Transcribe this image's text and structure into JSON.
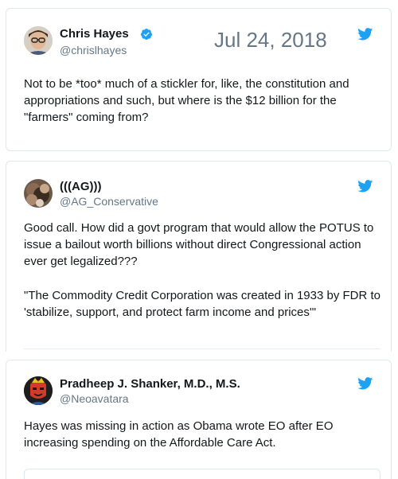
{
  "tweets": [
    {
      "name": "Chris Hayes",
      "handle": "@chrislhayes",
      "date": "Jul 24, 2018",
      "text": "Not to be *too* much of a stickler for, like, the constitution and appropriations and such, but where is the $12 billion for the \"farmers\" coming from?",
      "verified": true,
      "icon": "twitter-bird-icon"
    },
    {
      "name": "(((AG)))",
      "handle": "@AG_Conservative",
      "text1": "Good call. How did a govt program that would allow the POTUS to issue a bailout worth billions without direct Congressional action ever get legalized???",
      "text2": "\"The Commodity Credit Corporation was created in 1933 by FDR to 'stabilize, support, and protect farm income and prices'\"",
      "icon": "twitter-bird-icon"
    },
    {
      "name": "Pradheep J. Shanker, M.D., M.S.",
      "handle": "@Neoavatara",
      "text": "Hayes was missing in action as Obama wrote EO after EO increasing spending on the Affordable Care Act.",
      "icon": "twitter-bird-icon"
    }
  ],
  "colors": {
    "twitter_blue": "#1da1f2",
    "handle_gray": "#657786",
    "border": "#e1e8ed"
  }
}
